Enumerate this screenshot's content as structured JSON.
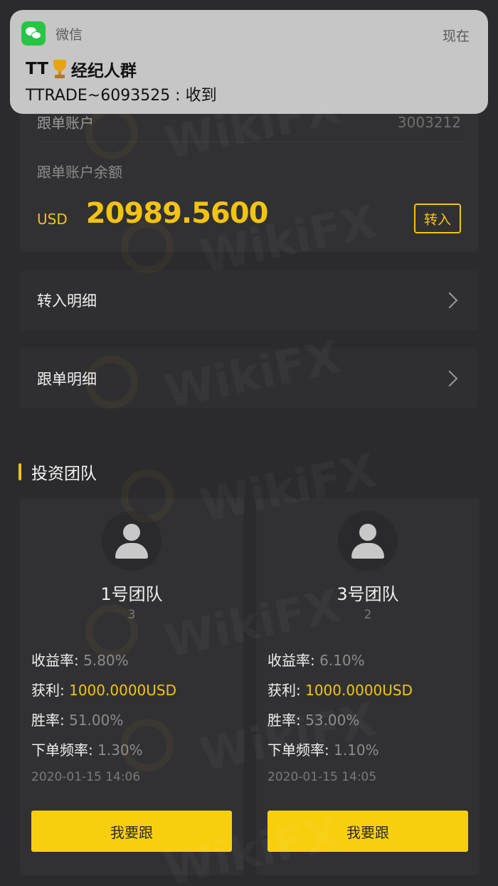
{
  "notification": {
    "app_name": "微信",
    "time": "现在",
    "title_prefix": "TT",
    "title_suffix": "经纪人群",
    "body": "TTRADE~6093525 : 收到",
    "app_icon": "wechat-icon",
    "emoji_icon": "trophy-icon"
  },
  "account": {
    "label": "跟单账户",
    "number": "3003212",
    "balance_label": "跟单账户余额",
    "currency": "USD",
    "balance": "20989.5600",
    "transfer_label": "转入"
  },
  "menu": [
    {
      "label": "转入明细",
      "icon": "chevron-right-icon"
    },
    {
      "label": "跟单明细",
      "icon": "chevron-right-icon"
    }
  ],
  "section_title": "投资团队",
  "teams": [
    {
      "name": "1号团队",
      "count": "3",
      "yield_label": "收益率:",
      "yield": "5.80%",
      "profit_label": "获利:",
      "profit": "1000.0000USD",
      "win_label": "胜率:",
      "win": "51.00%",
      "freq_label": "下单频率:",
      "freq": "1.30%",
      "date": "2020-01-15 14:06",
      "follow_label": "我要跟"
    },
    {
      "name": "3号团队",
      "count": "2",
      "yield_label": "收益率:",
      "yield": "6.10%",
      "profit_label": "获利:",
      "profit": "1000.0000USD",
      "win_label": "胜率:",
      "win": "53.00%",
      "freq_label": "下单频率:",
      "freq": "1.10%",
      "date": "2020-01-15 14:05",
      "follow_label": "我要跟"
    }
  ],
  "colors": {
    "accent": "#f3c312",
    "button": "#f7cf0f",
    "background": "#2b2b2d",
    "card": "#313133"
  },
  "watermark": "WikiFX"
}
